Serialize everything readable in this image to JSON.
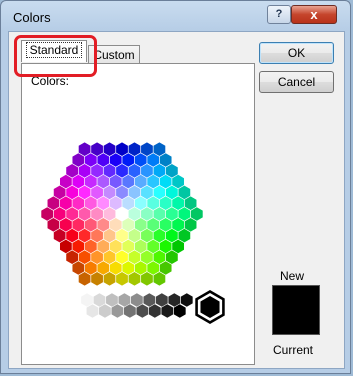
{
  "window": {
    "title": "Colors",
    "help_label": "?",
    "close_label": "x"
  },
  "tabs": {
    "standard": "Standard",
    "custom": "Custom"
  },
  "panel": {
    "colors_label": "Colors:"
  },
  "buttons": {
    "ok": "OK",
    "cancel": "Cancel"
  },
  "preview": {
    "new_label": "New",
    "current_label": "Current",
    "new_color": "#000000",
    "current_color": "#000000"
  },
  "accent": {
    "annotation": "#e21d25"
  }
}
